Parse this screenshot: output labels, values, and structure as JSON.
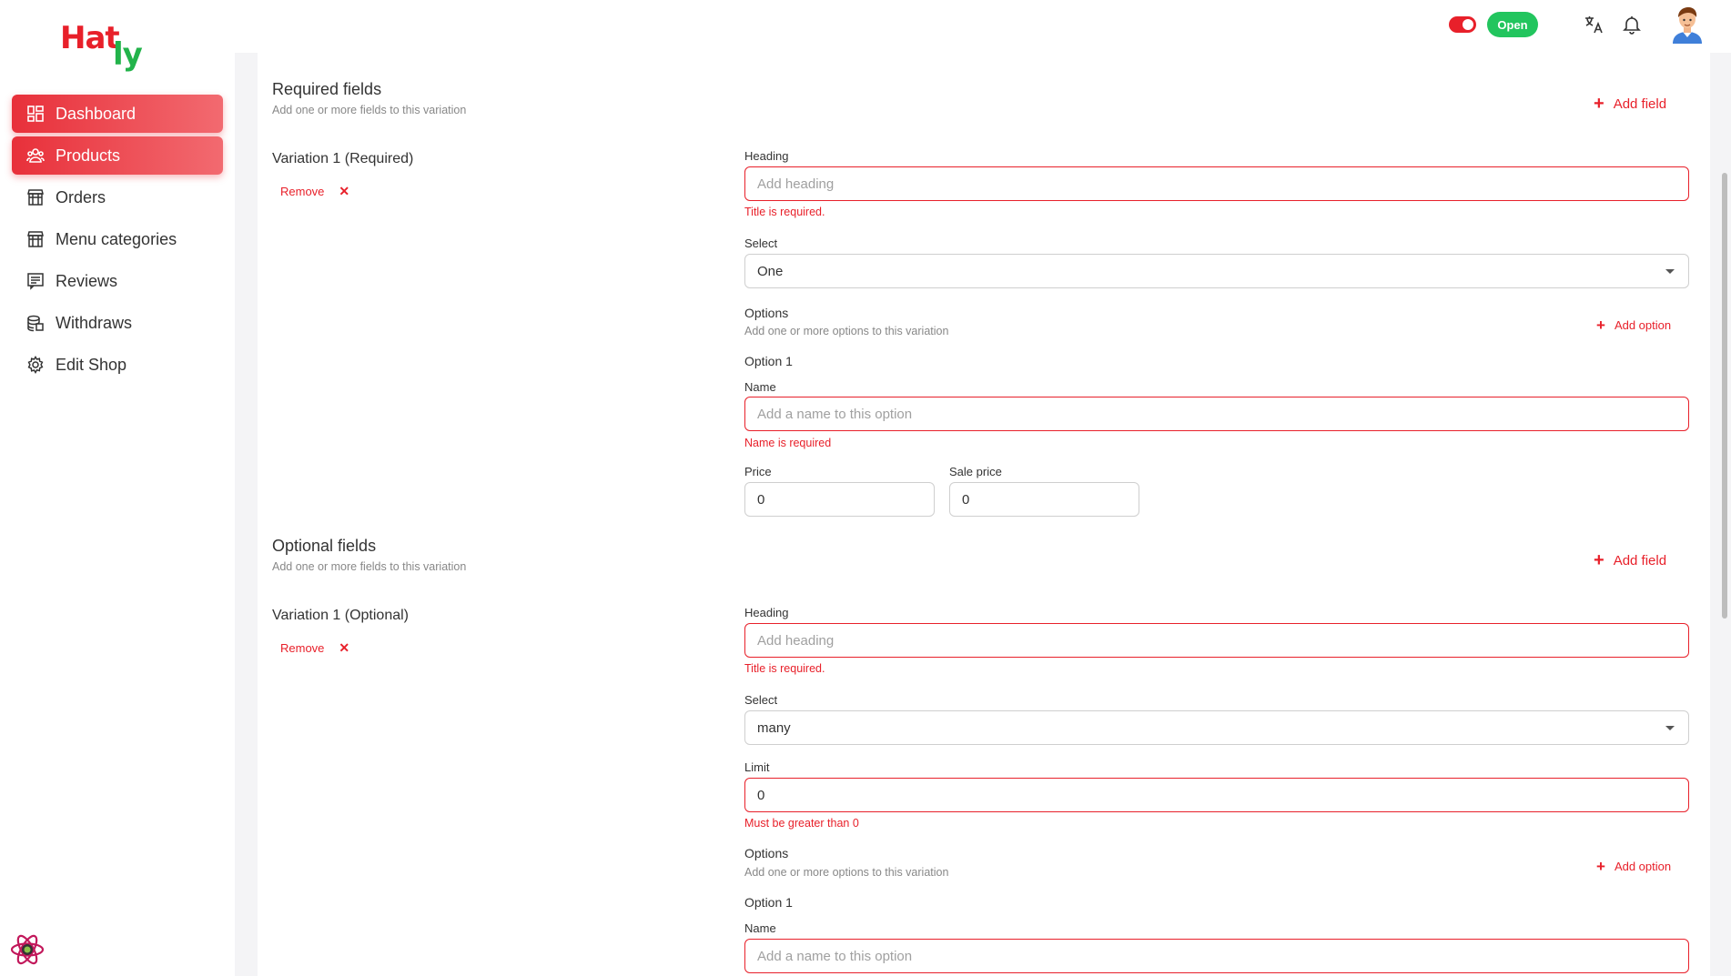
{
  "logo": {
    "part1": "Hat",
    "part2": "ly"
  },
  "sidebar": {
    "items": [
      {
        "label": "Dashboard",
        "icon": "dashboard-icon",
        "active": true
      },
      {
        "label": "Products",
        "icon": "products-icon",
        "active": true
      },
      {
        "label": "Orders",
        "icon": "orders-icon",
        "active": false
      },
      {
        "label": "Menu categories",
        "icon": "menu-categories-icon",
        "active": false
      },
      {
        "label": "Reviews",
        "icon": "reviews-icon",
        "active": false
      },
      {
        "label": "Withdraws",
        "icon": "withdraws-icon",
        "active": false
      },
      {
        "label": "Edit Shop",
        "icon": "gear-icon",
        "active": false
      }
    ]
  },
  "topbar": {
    "status_label": "Open",
    "status_toggle_on": true
  },
  "required_section": {
    "title": "Required fields",
    "subtitle": "Add one or more fields to this variation",
    "add_field_label": "Add field",
    "variation_title": "Variation 1 (Required)",
    "remove_label": "Remove",
    "heading_label": "Heading",
    "heading_placeholder": "Add heading",
    "heading_error": "Title is required.",
    "select_label": "Select",
    "select_value": "One",
    "options_title": "Options",
    "options_subtitle": "Add one or more options to this variation",
    "add_option_label": "Add option",
    "option_title": "Option 1",
    "name_label": "Name",
    "name_placeholder": "Add a name to this option",
    "name_error": "Name is required",
    "price_label": "Price",
    "price_value": "0",
    "sale_price_label": "Sale price",
    "sale_price_value": "0"
  },
  "optional_section": {
    "title": "Optional fields",
    "subtitle": "Add one or more fields to this variation",
    "add_field_label": "Add field",
    "variation_title": "Variation 1 (Optional)",
    "remove_label": "Remove",
    "heading_label": "Heading",
    "heading_placeholder": "Add heading",
    "heading_error": "Title is required.",
    "select_label": "Select",
    "select_value": "many",
    "limit_label": "Limit",
    "limit_value": "0",
    "limit_error": "Must be greater than 0",
    "options_title": "Options",
    "options_subtitle": "Add one or more options to this variation",
    "add_option_label": "Add option",
    "option_title": "Option 1",
    "name_label": "Name",
    "name_placeholder": "Add a name to this option"
  },
  "colors": {
    "accent": "#e8202a",
    "success": "#22c55e",
    "brand_green": "#22b34a"
  }
}
